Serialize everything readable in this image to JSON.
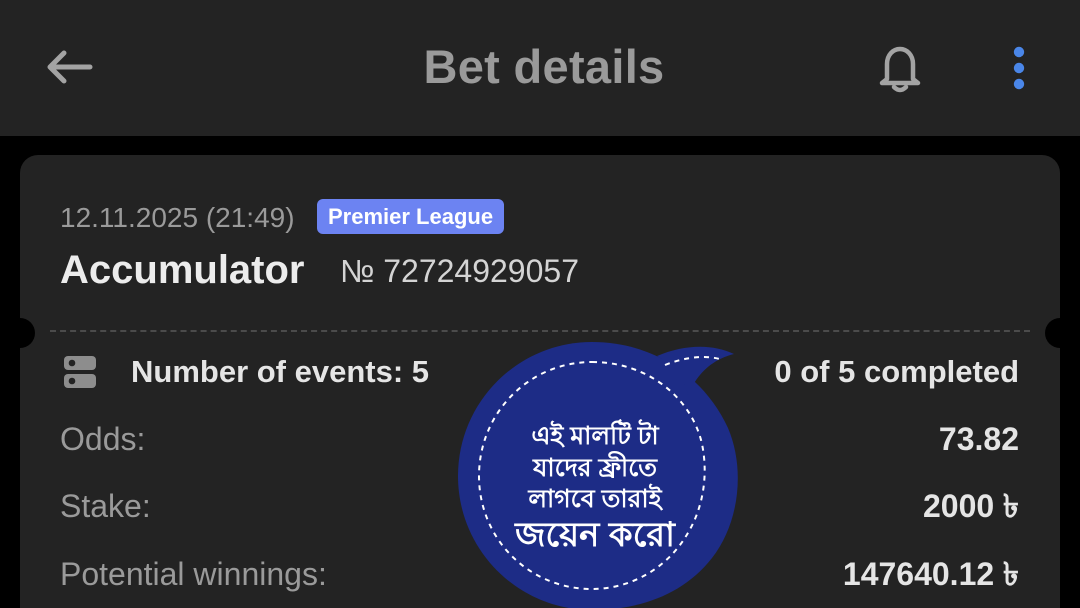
{
  "header": {
    "title": "Bet details",
    "icons": {
      "back": "back-arrow-icon",
      "notifications": "bell-icon",
      "more": "more-vertical-icon"
    }
  },
  "bet": {
    "datetime": "12.11.2025 (21:49)",
    "league": "Premier League",
    "type": "Accumulator",
    "number": "№ 72724929057"
  },
  "summary": {
    "events_label": "Number of events: 5",
    "status": "0 of 5 completed",
    "icon": "events-list-icon"
  },
  "details": {
    "odds_label": "Odds:",
    "odds_value": "73.82",
    "stake_label": "Stake:",
    "stake_value": "2000 ৳",
    "winnings_label": "Potential winnings:",
    "winnings_value": "147640.12 ৳"
  },
  "promo": {
    "line_1": "এই মালটি টা",
    "line_2": "যাদের ফ্রীতে",
    "line_3": "লাগবে তারাই",
    "line_4": "জয়েন করো"
  },
  "colors": {
    "header_bg": "#232323",
    "card_bg": "#232323",
    "badge_bg": "#6c83f2",
    "accent_blue": "#4a86e8",
    "promo_bg": "#1d2c86"
  }
}
